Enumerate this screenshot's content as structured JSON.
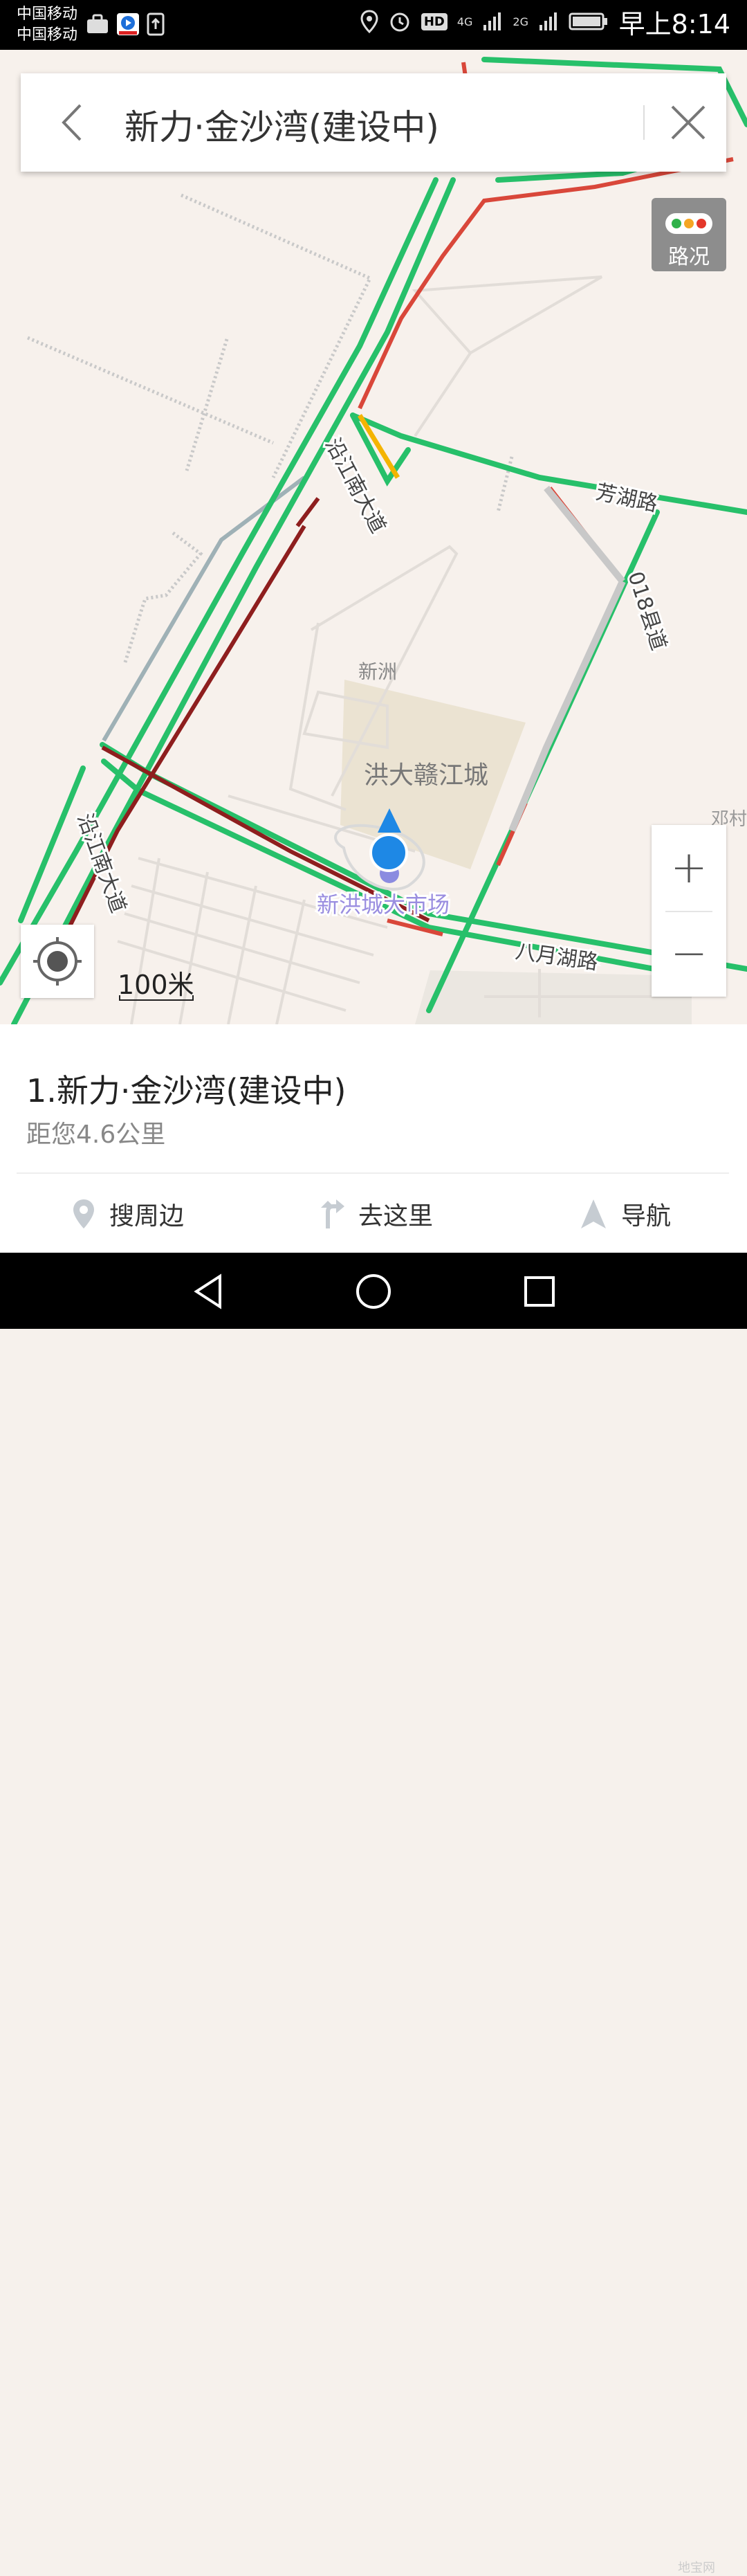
{
  "status_bar": {
    "carrier_1": "中国移动",
    "carrier_2": "中国移动",
    "time": "早上8:14",
    "network_1": "4G",
    "network_2": "2G",
    "hd_badge": "HD"
  },
  "search": {
    "query": "新力·金沙湾(建设中)"
  },
  "traffic_button": {
    "label": "路况",
    "light_colors": [
      "#2fb24a",
      "#f5a623",
      "#e4372a"
    ]
  },
  "map": {
    "road_labels": [
      "沿江南大道",
      "沿江南大道",
      "芳湖路",
      "018县道",
      "八月湖路"
    ],
    "place_labels": {
      "district": "新洲",
      "area": "洪大赣江城",
      "poi": "新洪城大市场",
      "village": "邓村"
    },
    "scale_label": "100米",
    "colors": {
      "road_clear": "#27c06a",
      "road_slow": "#f4b400",
      "road_jam": "#d9473a",
      "road_severe": "#8e1e1e",
      "location_dot": "#1e88e5"
    }
  },
  "zoom": {
    "plus": "+",
    "minus": "−"
  },
  "result_card": {
    "title": "1.新力·金沙湾(建设中)",
    "distance": "距您4.6公里",
    "actions": [
      {
        "label": "搜周边",
        "icon": "pin-icon"
      },
      {
        "label": "去这里",
        "icon": "route-icon"
      },
      {
        "label": "导航",
        "icon": "navigation-arrow-icon"
      }
    ]
  },
  "watermark": "地宝网"
}
